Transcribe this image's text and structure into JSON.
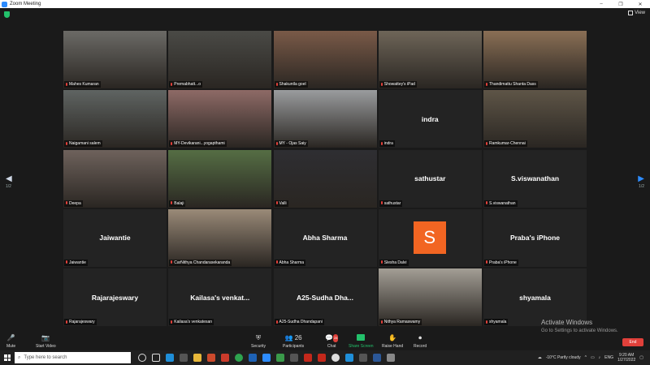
{
  "window": {
    "title": "Zoom Meeting",
    "minimize": "–",
    "maximize": "❐",
    "close": "✕"
  },
  "topbar": {
    "view_label": "View"
  },
  "pagination": {
    "left_page": "1/2",
    "right_page": "1/2",
    "left_arrow": "◀",
    "right_arrow": "▶"
  },
  "tiles": [
    {
      "big_name": "",
      "label": "Mahes Kumaran",
      "video": true,
      "tone": "#6b6a66"
    },
    {
      "big_name": "",
      "label": "Premabhatt...o",
      "video": true,
      "tone": "#4a4a46",
      "active": true
    },
    {
      "big_name": "",
      "label": "Shakuntla goel",
      "video": true,
      "tone": "#7a5a48"
    },
    {
      "big_name": "",
      "label": "Showattey's iPad",
      "video": true,
      "tone": "#6e6558"
    },
    {
      "big_name": "",
      "label": "Thandimattu Shanta Dass",
      "video": true,
      "tone": "#8a6f55"
    },
    {
      "big_name": "",
      "label": "Naigamani salem",
      "video": true,
      "tone": "#5f6462"
    },
    {
      "big_name": "",
      "label": "MY-Devikarani...yogapthami",
      "video": true,
      "tone": "#8e6a66"
    },
    {
      "big_name": "",
      "label": "MY - Ojas Saiy",
      "video": true,
      "tone": "#9a9c9e"
    },
    {
      "big_name": "indra",
      "label": "indra",
      "video": false
    },
    {
      "big_name": "",
      "label": "Ramkumar-Chennai",
      "video": true,
      "tone": "#5e5547"
    },
    {
      "big_name": "",
      "label": "Deepa",
      "video": true,
      "tone": "#6e625c"
    },
    {
      "big_name": "",
      "label": "Balaji",
      "video": true,
      "tone": "#556e44"
    },
    {
      "big_name": "",
      "label": "Valli",
      "video": true,
      "tone": "#2e2e32"
    },
    {
      "big_name": "sathustar",
      "label": "sathustar",
      "video": false
    },
    {
      "big_name": "S.viswanathan",
      "label": "S.viswanathan",
      "video": false
    },
    {
      "big_name": "Jaiwantie",
      "label": "Jaiwantie",
      "video": false
    },
    {
      "big_name": "",
      "label": "CarNithya Chandarasekaranda",
      "video": true,
      "tone": "#9a8a78"
    },
    {
      "big_name": "Abha Sharma",
      "label": "Abha Sharma",
      "video": false
    },
    {
      "big_name": "",
      "label": "Slesha Dalvi",
      "video": false,
      "avatar": "S"
    },
    {
      "big_name": "Praba's iPhone",
      "label": "Praba's iPhone",
      "video": false
    },
    {
      "big_name": "Rajarajeswary",
      "label": "Rajarajeswary",
      "video": false
    },
    {
      "big_name": "Kailasa's venkat...",
      "label": "Kailasa's venkatesan",
      "video": false
    },
    {
      "big_name": "A25-Sudha Dha...",
      "label": "A25-Sudha Dhandapani",
      "video": false
    },
    {
      "big_name": "",
      "label": "Nithya Ramaswamy",
      "video": true,
      "tone": "#a39e95"
    },
    {
      "big_name": "shyamala",
      "label": "shyamala",
      "video": false
    }
  ],
  "controls": {
    "mute": "Mute",
    "start_video": "Start Video",
    "security": "Security",
    "participants": "Participants",
    "participants_count": "26",
    "chat": "Chat",
    "chat_badge": "28",
    "share_screen": "Share Screen",
    "raise_hand": "Raise Hand",
    "record": "Record",
    "end": "End"
  },
  "watermark": {
    "title": "Activate Windows",
    "subtitle": "Go to Settings to activate Windows."
  },
  "taskbar": {
    "search_placeholder": "Type here to search",
    "weather": "-10°C  Partly cloudy",
    "language": "ENG",
    "time": "9:20 AM",
    "date": "1/27/2022"
  }
}
